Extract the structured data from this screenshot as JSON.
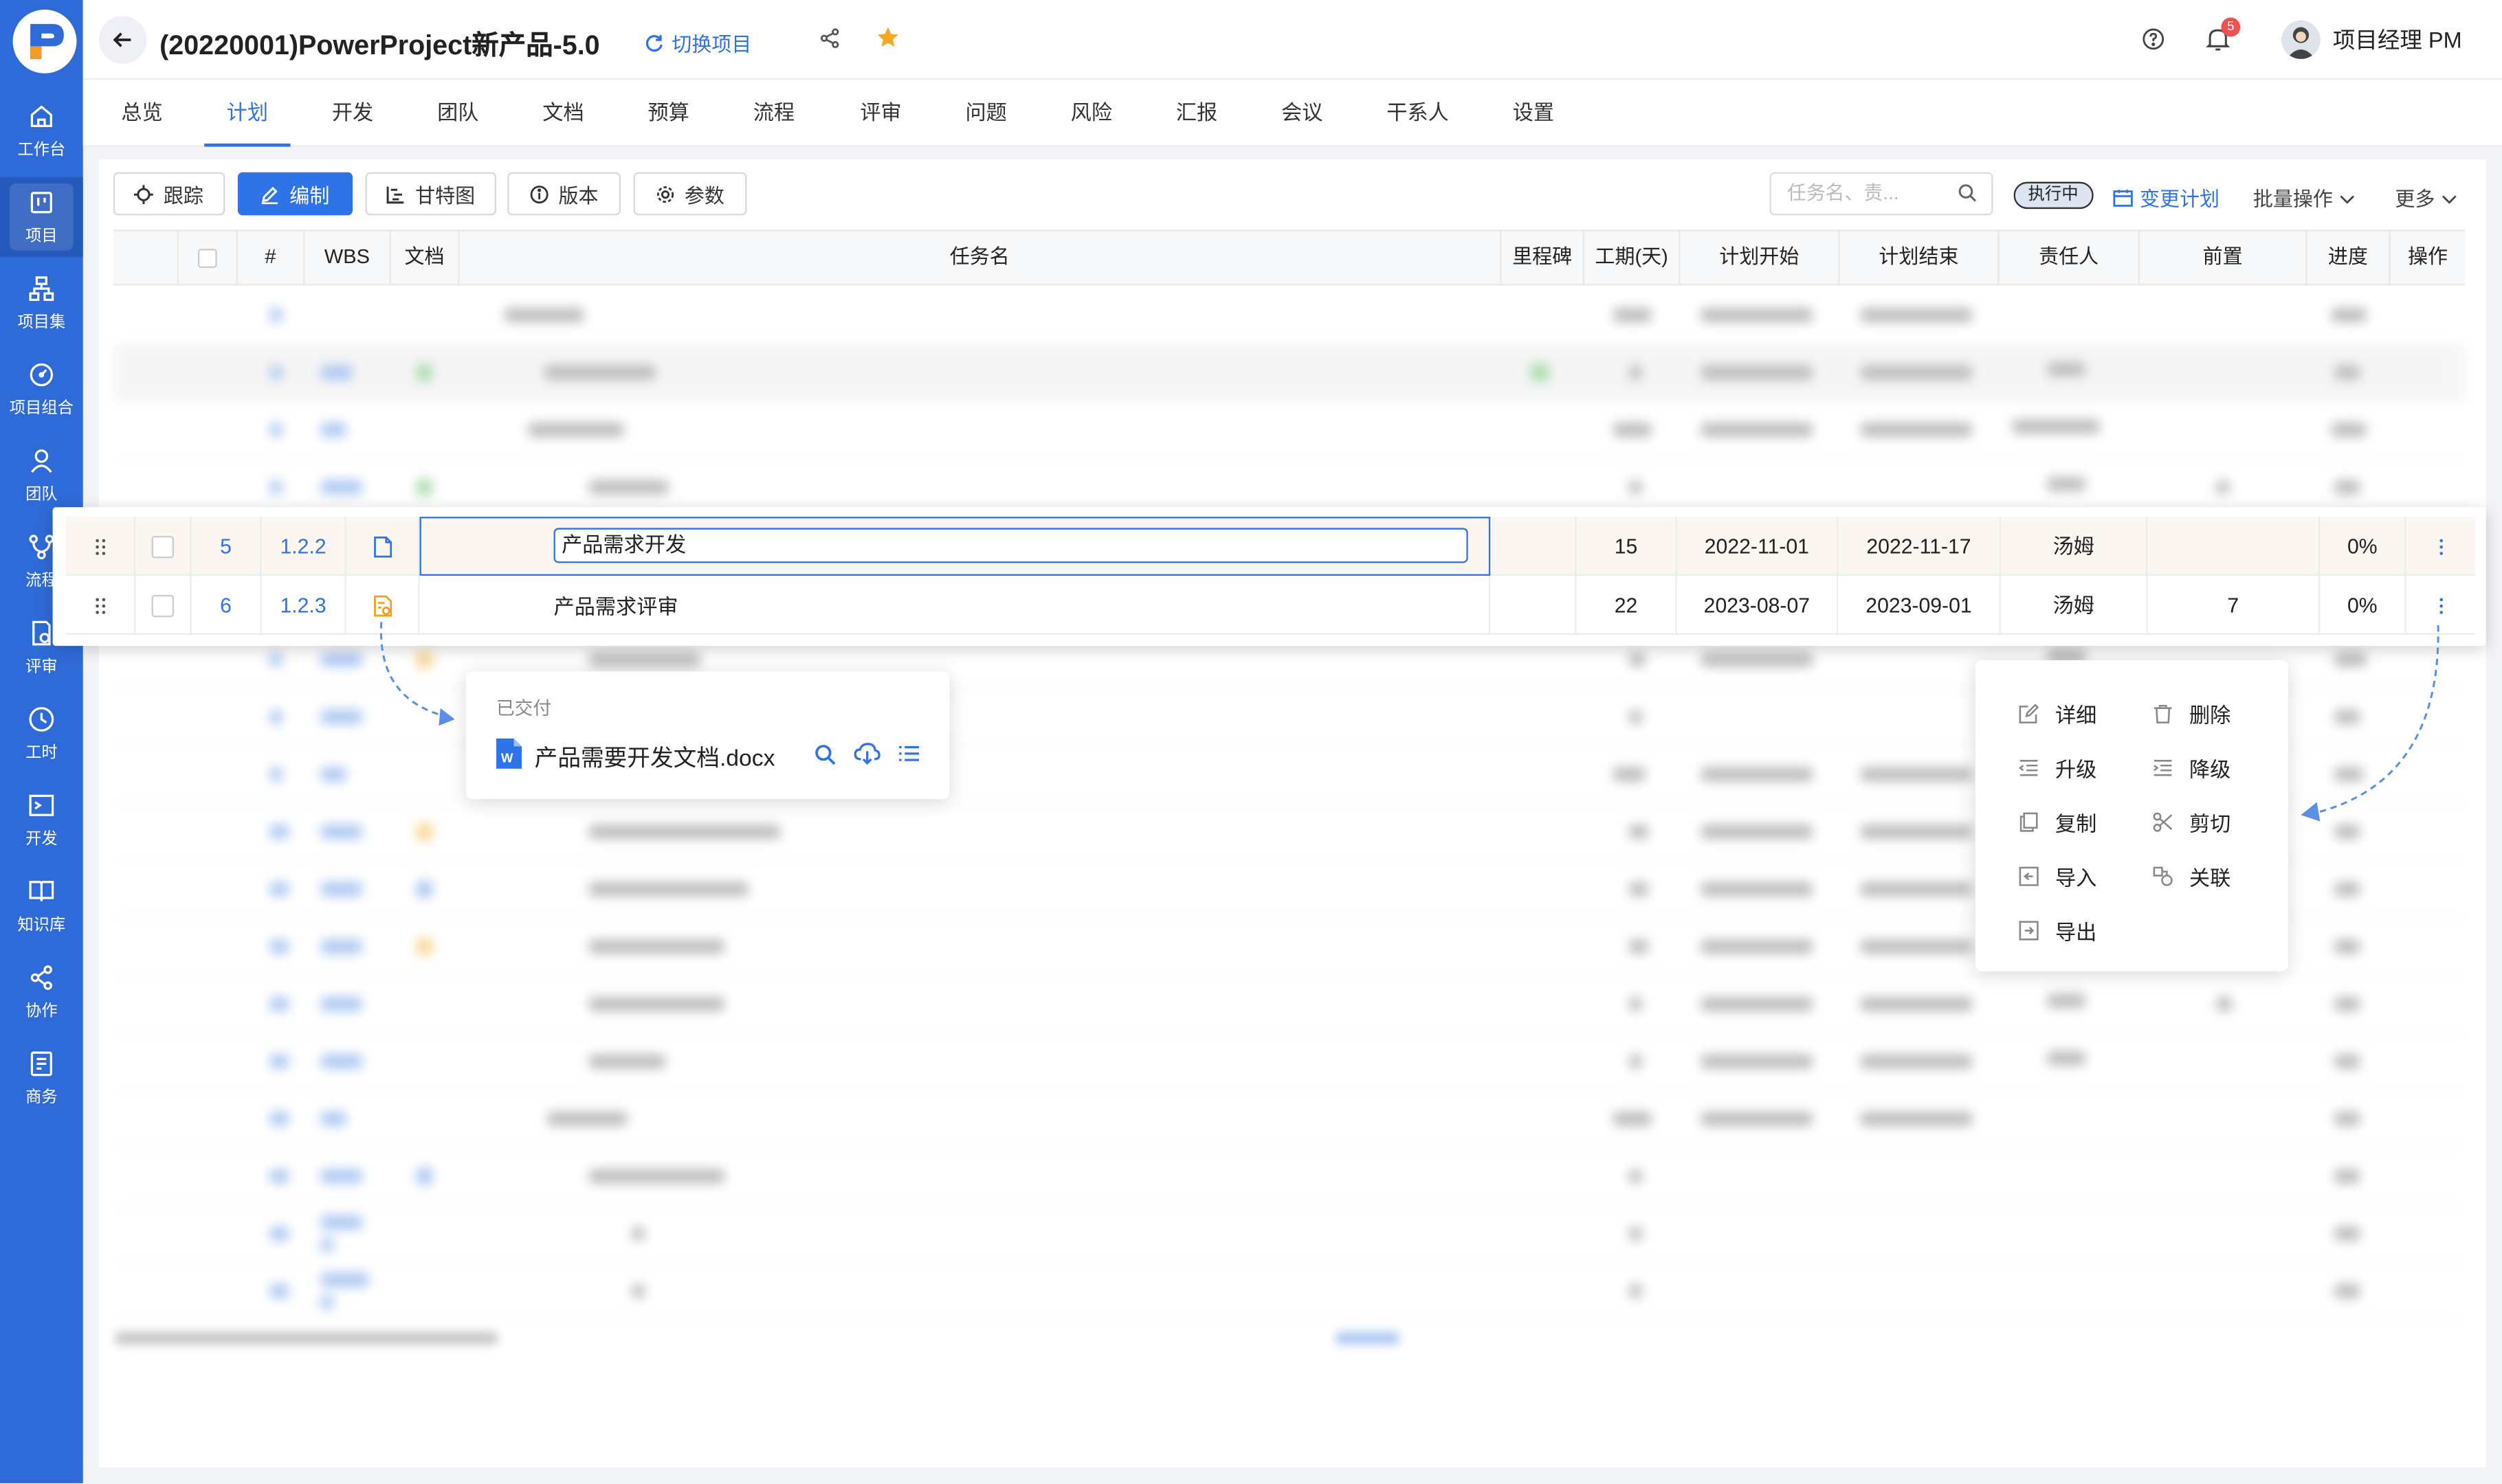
{
  "header": {
    "title": "(20220001)PowerProject新产品-5.0",
    "switch_label": "切换项目",
    "notification_count": "5",
    "user_name": "项目经理 PM"
  },
  "sidebar": {
    "items": [
      {
        "label": "工作台",
        "icon": "home-icon"
      },
      {
        "label": "项目",
        "icon": "project-icon"
      },
      {
        "label": "项目集",
        "icon": "program-icon"
      },
      {
        "label": "项目组合",
        "icon": "portfolio-icon"
      },
      {
        "label": "团队",
        "icon": "team-icon"
      },
      {
        "label": "流程",
        "icon": "flow-icon"
      },
      {
        "label": "评审",
        "icon": "review-icon"
      },
      {
        "label": "工时",
        "icon": "clock-icon"
      },
      {
        "label": "开发",
        "icon": "terminal-icon"
      },
      {
        "label": "知识库",
        "icon": "book-icon"
      },
      {
        "label": "协作",
        "icon": "share-icon"
      },
      {
        "label": "商务",
        "icon": "business-icon"
      }
    ]
  },
  "tabs": [
    "总览",
    "计划",
    "开发",
    "团队",
    "文档",
    "预算",
    "流程",
    "评审",
    "问题",
    "风险",
    "汇报",
    "会议",
    "干系人",
    "设置"
  ],
  "toolbar": {
    "track": "跟踪",
    "edit": "编制",
    "gantt": "甘特图",
    "version": "版本",
    "params": "参数",
    "search_placeholder": "任务名、责...",
    "status": "执行中",
    "change_plan": "变更计划",
    "batch": "批量操作",
    "more": "更多"
  },
  "table": {
    "columns": [
      "#",
      "WBS",
      "文档",
      "任务名",
      "里程碑",
      "工期(天)",
      "计划开始",
      "计划结束",
      "责任人",
      "前置",
      "进度",
      "操作"
    ],
    "rows": [
      {
        "no": "5",
        "wbs": "1.2.2",
        "name": "产品需求开发",
        "duration": "15",
        "start": "2022-11-01",
        "end": "2022-11-17",
        "owner": "汤姆",
        "pred": "",
        "progress": "0%"
      },
      {
        "no": "6",
        "wbs": "1.2.3",
        "name": "产品需求评审",
        "duration": "22",
        "start": "2023-08-07",
        "end": "2023-09-01",
        "owner": "汤姆",
        "pred": "7",
        "progress": "0%"
      }
    ]
  },
  "doc_popup": {
    "status": "已交付",
    "filename": "产品需要开发文档.docx"
  },
  "context_menu": {
    "items": [
      {
        "label": "详细",
        "icon": "edit-icon"
      },
      {
        "label": "删除",
        "icon": "trash-icon"
      },
      {
        "label": "升级",
        "icon": "outdent-icon"
      },
      {
        "label": "降级",
        "icon": "indent-icon"
      },
      {
        "label": "复制",
        "icon": "copy-icon"
      },
      {
        "label": "剪切",
        "icon": "scissors-icon"
      },
      {
        "label": "导入",
        "icon": "import-icon"
      },
      {
        "label": "关联",
        "icon": "link-icon"
      },
      {
        "label": "导出",
        "icon": "export-icon"
      }
    ]
  },
  "colors": {
    "primary": "#2f73e8",
    "sidebar": "#2f6bd8",
    "star": "#f5a623"
  }
}
